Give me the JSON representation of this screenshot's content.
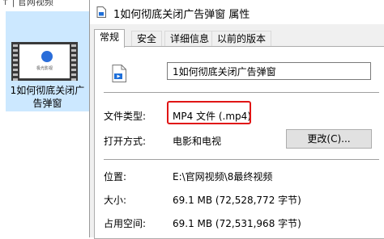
{
  "explorer": {
    "breadcrumb": "↑ | 官网视频",
    "thumb_label": "1如何彻底关闭广告弹窗",
    "thumb_logo_text": "极光影视"
  },
  "dialog": {
    "title": "1如何彻底关闭广告弹窗 属性",
    "tabs": [
      "常规",
      "安全",
      "详细信息",
      "以前的版本"
    ],
    "file_name": "1如何彻底关闭广告弹窗",
    "file_type_label": "文件类型:",
    "file_type_value": "MP4 文件 (.mp4)",
    "open_with_label": "打开方式:",
    "open_with_value": "电影和电视",
    "change_button": "更改(C)...",
    "location_label": "位置:",
    "location_value": "E:\\官网视频\\8最终视频",
    "size_label": "大小:",
    "size_value": "69.1 MB (72,528,772 字节)",
    "disk_size_label": "占用空间:",
    "disk_size_value": "69.1 MB (72,531,968 字节)"
  },
  "colors": {
    "highlight": "#e01515",
    "selection": "#cce8ff"
  }
}
